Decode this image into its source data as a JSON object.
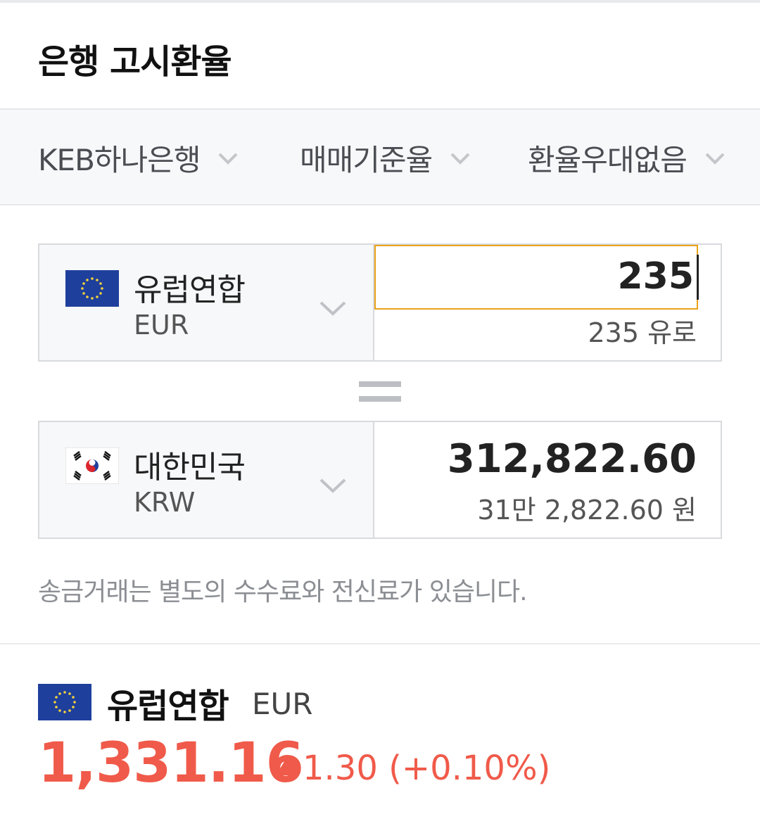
{
  "header": {
    "title": "은행 고시환율"
  },
  "filters": [
    {
      "label": "KEB하나은행"
    },
    {
      "label": "매매기준율"
    },
    {
      "label": "환율우대없음"
    }
  ],
  "from": {
    "country": "유럽연합",
    "code": "EUR",
    "amount": "235",
    "amount_text": "235 유로",
    "flag_icon": "eu-flag-icon"
  },
  "to": {
    "country": "대한민국",
    "code": "KRW",
    "amount": "312,822.60",
    "amount_text": "31만 2,822.60 원",
    "flag_icon": "korea-flag-icon"
  },
  "notice": "송금거래는 별도의 수수료와 전신료가 있습니다.",
  "rate": {
    "country": "유럽연합",
    "code": "EUR",
    "value": "1,331.16",
    "change": "1.30 (+0.10%)"
  },
  "colors": {
    "accent_up": "#f05a4a",
    "focus": "#e8a219"
  }
}
